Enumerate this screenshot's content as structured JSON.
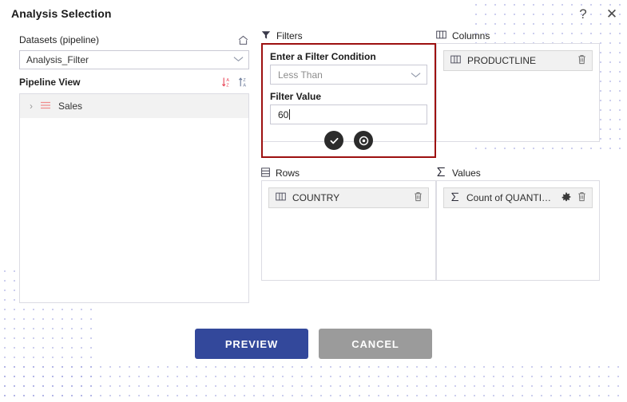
{
  "dialog": {
    "title": "Analysis Selection",
    "help_icon": "question-mark-icon",
    "close_icon": "close-icon",
    "help_glyph": "?",
    "close_glyph": "✕"
  },
  "left": {
    "datasets_label": "Datasets (pipeline)",
    "home_icon": "home-icon",
    "dataset_value": "Analysis_Filter",
    "dataset_chevron": "chevron-down-icon",
    "pipeline_label": "Pipeline View",
    "sort_asc_icon": "sort-alpha-ascending-icon",
    "sort_desc_icon": "sort-alpha-descending-icon",
    "tree": [
      {
        "expander": "›",
        "icon": "list-lines-icon",
        "label": "Sales"
      }
    ]
  },
  "filters": {
    "heading": "Filters",
    "heading_icon": "funnel-icon",
    "condition_label": "Enter a Filter Condition",
    "condition_value": "Less Than",
    "condition_chevron": "chevron-down-icon",
    "value_label": "Filter Value",
    "value_text": "60",
    "confirm_icon": "check-circle-icon",
    "cancel_icon": "close-circle-icon"
  },
  "columns": {
    "heading": "Columns",
    "heading_icon": "table-columns-icon",
    "items": [
      {
        "icon": "column-icon",
        "label": "PRODUCTLINE",
        "delete_icon": "trash-icon"
      }
    ]
  },
  "rows": {
    "heading": "Rows",
    "heading_icon": "table-rows-icon",
    "items": [
      {
        "icon": "column-icon",
        "label": "COUNTRY",
        "delete_icon": "trash-icon"
      }
    ]
  },
  "values": {
    "heading": "Values",
    "heading_icon": "sigma-icon",
    "items": [
      {
        "icon": "sigma-icon",
        "label": "Count of QUANTITYOR...",
        "settings_icon": "gear-icon",
        "delete_icon": "trash-icon"
      }
    ]
  },
  "footer": {
    "preview_label": "PREVIEW",
    "cancel_label": "CANCEL"
  },
  "colors": {
    "primary": "#33489b",
    "cancel": "#9b9b9b",
    "highlight": "#9d1010",
    "accent_red": "#e8787d",
    "dots": "#8a8ed8"
  }
}
